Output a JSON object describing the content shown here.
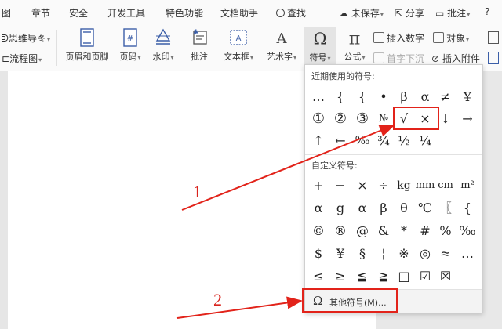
{
  "menu_tabs": [
    "图",
    "章节",
    "安全",
    "开发工具",
    "特色功能",
    "文档助手"
  ],
  "search_label": "查找",
  "right_tools": {
    "unsaved": "未保存",
    "share": "分享",
    "annotate": "批注"
  },
  "ribbon": {
    "left_small": [
      "思维导图",
      "流程图"
    ],
    "buttons": [
      "页眉和页脚",
      "页码",
      "水印",
      "批注",
      "文本框",
      "艺术字",
      "符号",
      "公式"
    ],
    "right_small": {
      "insert_number": "插入数字",
      "object": "对象",
      "drop_cap": "首字下沉",
      "attachment": "插入附件"
    }
  },
  "symbol_panel": {
    "recent_title": "近期使用的符号:",
    "recent": [
      [
        "…",
        "{",
        "{",
        "•",
        "β",
        "α",
        "≠",
        "¥"
      ],
      [
        "①",
        "②",
        "③",
        "№",
        "√",
        "×",
        "↓",
        "→"
      ],
      [
        "↑",
        "←",
        "‰",
        "¾",
        "½",
        "¼"
      ]
    ],
    "custom_title": "自定义符号:",
    "custom": [
      [
        "+",
        "−",
        "×",
        "÷",
        "kg",
        "mm",
        "cm",
        "m²"
      ],
      [
        "α",
        "g",
        "α",
        "β",
        "θ",
        "℃",
        "〖",
        "{"
      ],
      [
        "©",
        "®",
        "@",
        "&",
        "*",
        "#",
        "%",
        "‰"
      ],
      [
        "$",
        "¥",
        "§",
        "¦",
        "※",
        "◎",
        "≈",
        "…"
      ],
      [
        "≤",
        "≥",
        "≦",
        "≧",
        "□",
        "☑",
        "☒"
      ]
    ],
    "more_label": "其他符号(M)..."
  },
  "annotations": [
    "1",
    "2"
  ],
  "colors": {
    "accent_red": "#e2231a",
    "ribbon_bg": "#fafafa",
    "panel_bg": "#ffffff"
  }
}
